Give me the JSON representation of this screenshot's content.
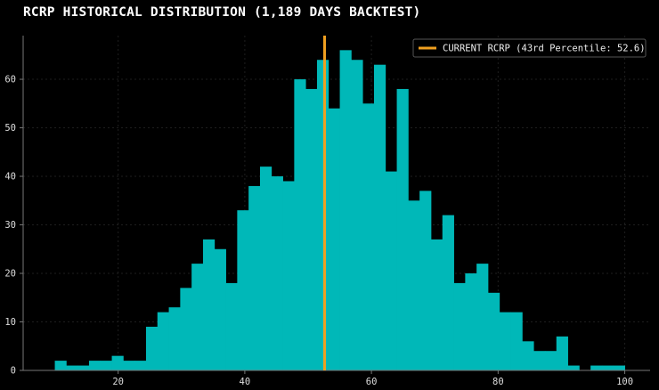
{
  "chart_title": "RCRP HISTORICAL DISTRIBUTION (1,189 DAYS BACKTEST)",
  "colors": {
    "background": "#000000",
    "bars": "#00b8b8",
    "marker": "#f0a020",
    "grid": "#1e1e1e",
    "axis": "#777777"
  },
  "chart_data": {
    "type": "bar",
    "subtype": "histogram",
    "title": "RCRP HISTORICAL DISTRIBUTION (1,189 DAYS BACKTEST)",
    "xlabel": "",
    "ylabel": "",
    "xlim": [
      5,
      104
    ],
    "ylim": [
      0,
      69
    ],
    "grid": true,
    "x_ticks": [
      20,
      40,
      60,
      80,
      100
    ],
    "y_ticks": [
      0,
      10,
      20,
      30,
      40,
      50,
      60
    ],
    "bin_edges": [
      10,
      11.8,
      13.6,
      15.4,
      17.2,
      19,
      20.8,
      22.6,
      24.4,
      26.2,
      28,
      29.8,
      31.6,
      33.4,
      35.2,
      37,
      38.8,
      40.6,
      42.4,
      44.2,
      46,
      47.8,
      49.6,
      51.4,
      53.2,
      55,
      56.8,
      58.6,
      60.4,
      62.2,
      64,
      65.8,
      67.6,
      69.4,
      71.2,
      73,
      74.8,
      76.6,
      78.4,
      80.2,
      82,
      83.8,
      85.6,
      87.4,
      89.2,
      91,
      92.8,
      94.6,
      96.4,
      98.2,
      100
    ],
    "counts": [
      2,
      1,
      1,
      2,
      2,
      3,
      2,
      2,
      9,
      12,
      13,
      17,
      22,
      27,
      25,
      18,
      33,
      38,
      42,
      40,
      39,
      60,
      58,
      64,
      54,
      66,
      64,
      55,
      63,
      41,
      58,
      35,
      37,
      27,
      32,
      18,
      20,
      22,
      16,
      12,
      12,
      6,
      4,
      4,
      7,
      1,
      0,
      1,
      1,
      1
    ],
    "marker": {
      "x": 52.6,
      "label": "CURRENT RCRP (43rd Percentile: 52.6)"
    },
    "legend": {
      "position": "top-right",
      "entries": [
        "CURRENT RCRP (43rd Percentile: 52.6)"
      ]
    }
  }
}
